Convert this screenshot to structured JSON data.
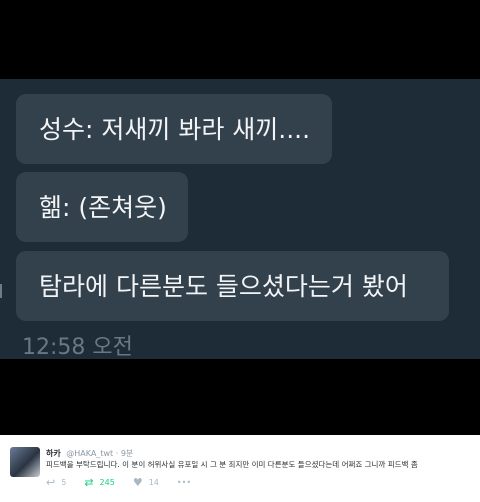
{
  "chat": {
    "messages": [
      "성수: 저새끼 봐라 새끼....",
      "헮: (존쳐웃)",
      "탐라에 다른분도 들으셨다는거 봤어"
    ],
    "time": "12:58 오전"
  },
  "tweet": {
    "name": "하카",
    "handle": "@HAKA_twt",
    "age": "9분",
    "text": "피드백을 부탁드립니다. 이 분이 허위사실 유포일 시 그 분 죄지만 이미 다른분도 들으셨다는데 어쩌죠 그니까 피드백 좀",
    "reply_count": "5",
    "retweet_count": "245",
    "like_count": "14",
    "more": "•••",
    "colors": {
      "retweet": "#19cf86",
      "muted": "#aab8c2"
    },
    "icons": [
      "reply-icon",
      "retweet-icon",
      "heart-icon",
      "more-icon"
    ]
  }
}
